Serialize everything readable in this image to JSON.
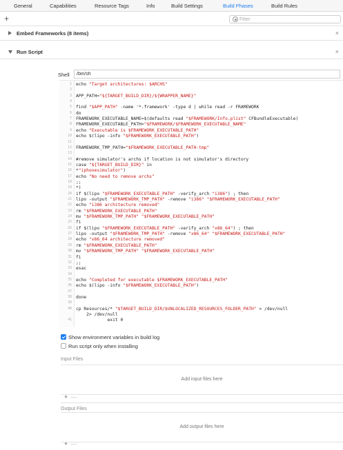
{
  "tabs": [
    {
      "label": "General"
    },
    {
      "label": "Capabilities"
    },
    {
      "label": "Resource Tags"
    },
    {
      "label": "Info"
    },
    {
      "label": "Build Settings"
    },
    {
      "label": "Build Phases"
    },
    {
      "label": "Build Rules"
    }
  ],
  "active_tab": "Build Phases",
  "toolbar": {
    "add_symbol": "+",
    "filter_placeholder": "Filter"
  },
  "phases": [
    {
      "title": "Embed Frameworks (8 items)",
      "expanded": false
    },
    {
      "title": "Run Script",
      "expanded": true
    }
  ],
  "close_symbol": "×",
  "shell": {
    "label": "Shell",
    "value": "/bin/sh"
  },
  "script_lines": [
    {
      "n": "1",
      "t": "echo \"Target architectures: $ARCHS\""
    },
    {
      "n": "2",
      "t": ""
    },
    {
      "n": "3",
      "t": "APP_PATH=\"${TARGET_BUILD_DIR}/${WRAPPER_NAME}\""
    },
    {
      "n": "4",
      "t": ""
    },
    {
      "n": "5",
      "t": "find \"$APP_PATH\" -name '*.framework' -type d | while read -r FRAMEWORK"
    },
    {
      "n": "6",
      "t": "do"
    },
    {
      "n": "7",
      "t": "FRAMEWORK_EXECUTABLE_NAME=$(defaults read \"$FRAMEWORK/Info.plist\" CFBundleExecutable)"
    },
    {
      "n": "8",
      "t": "FRAMEWORK_EXECUTABLE_PATH=\"$FRAMEWORK/$FRAMEWORK_EXECUTABLE_NAME\""
    },
    {
      "n": "9",
      "t": "echo \"Executable is $FRAMEWORK_EXECUTABLE_PATH\""
    },
    {
      "n": "10",
      "t": "echo $(lipo -info \"$FRAMEWORK_EXECUTABLE_PATH\")"
    },
    {
      "n": "11",
      "t": ""
    },
    {
      "n": "12",
      "t": "FRAMEWORK_TMP_PATH=\"$FRAMEWORK_EXECUTABLE_PATH-tmp\""
    },
    {
      "n": "13",
      "t": ""
    },
    {
      "n": "14",
      "t": "#remove simulator's archs if location is not simulator's directory"
    },
    {
      "n": "15",
      "t": "case \"${TARGET_BUILD_DIR}\" in"
    },
    {
      "n": "16",
      "t": "*\"iphonesimulator\")"
    },
    {
      "n": "17",
      "t": "echo \"No need to remove archs\""
    },
    {
      "n": "18",
      "t": ";;"
    },
    {
      "n": "19",
      "t": "*)"
    },
    {
      "n": "20",
      "t": "if $(lipo \"$FRAMEWORK_EXECUTABLE_PATH\" -verify_arch \"i386\") ; then"
    },
    {
      "n": "21",
      "t": "lipo -output \"$FRAMEWORK_TMP_PATH\" -remove \"i386\" \"$FRAMEWORK_EXECUTABLE_PATH\""
    },
    {
      "n": "22",
      "t": "echo \"i386 architecture removed\""
    },
    {
      "n": "23",
      "t": "rm \"$FRAMEWORK_EXECUTABLE_PATH\""
    },
    {
      "n": "24",
      "t": "mv \"$FRAMEWORK_TMP_PATH\" \"$FRAMEWORK_EXECUTABLE_PATH\""
    },
    {
      "n": "25",
      "t": "fi"
    },
    {
      "n": "26",
      "t": "if $(lipo \"$FRAMEWORK_EXECUTABLE_PATH\" -verify_arch \"x86_64\") ; then"
    },
    {
      "n": "27",
      "t": "lipo -output \"$FRAMEWORK_TMP_PATH\" -remove \"x86_64\" \"$FRAMEWORK_EXECUTABLE_PATH\""
    },
    {
      "n": "28",
      "t": "echo \"x86_64 architecture removed\""
    },
    {
      "n": "29",
      "t": "rm \"$FRAMEWORK_EXECUTABLE_PATH\""
    },
    {
      "n": "30",
      "t": "mv \"$FRAMEWORK_TMP_PATH\" \"$FRAMEWORK_EXECUTABLE_PATH\""
    },
    {
      "n": "31",
      "t": "fi"
    },
    {
      "n": "32",
      "t": ";;"
    },
    {
      "n": "33",
      "t": "esac"
    },
    {
      "n": "34",
      "t": ""
    },
    {
      "n": "35",
      "t": "echo \"Completed for executable $FRAMEWORK_EXECUTABLE_PATH\""
    },
    {
      "n": "36",
      "t": "echo $(lipo -info \"$FRAMEWORK_EXECUTABLE_PATH\")"
    },
    {
      "n": "37",
      "t": ""
    },
    {
      "n": "38",
      "t": "done"
    },
    {
      "n": "39",
      "t": ""
    },
    {
      "n": "40",
      "t": "cp Resources/* \"$TARGET_BUILD_DIR/$UNLOCALIZED_RESOURCES_FOLDER_PATH\" > /dev/null"
    },
    {
      "n": "",
      "t": "    2> /dev/null"
    },
    {
      "n": "41",
      "t": "            exit 0"
    }
  ],
  "options": [
    {
      "label": "Show environment variables in build log",
      "checked": true
    },
    {
      "label": "Run script only when installing",
      "checked": false
    }
  ],
  "input_files": {
    "label": "Input Files",
    "placeholder": "Add input files here"
  },
  "output_files": {
    "label": "Output Files",
    "placeholder": "Add output files here"
  },
  "list_controls": {
    "plus": "+",
    "minus": "—"
  },
  "colors": {
    "accent": "#1b7cf0",
    "string": "#c41a16"
  }
}
